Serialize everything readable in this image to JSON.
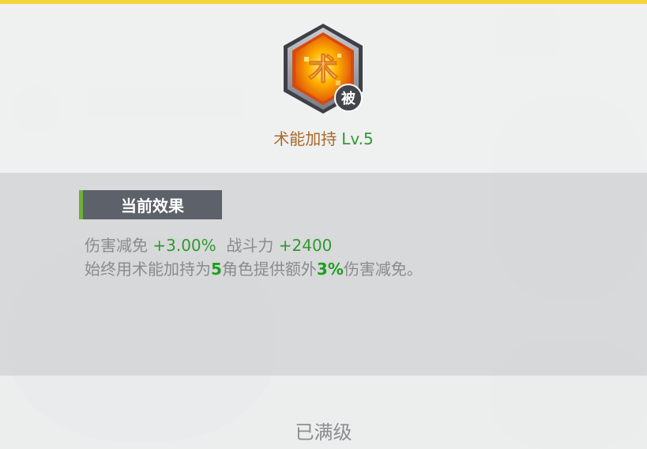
{
  "skill": {
    "name": "术能加持",
    "level": "Lv.5",
    "icon_char": "术",
    "passive_badge": "被",
    "icon_name": "skill-emblem-icon"
  },
  "effect": {
    "header": "当前效果",
    "stat1_label": "伤害减免",
    "stat1_value": "+3.00%",
    "stat2_label": "战斗力",
    "stat2_value": "+2400",
    "desc_part1": "始终用术能加持为",
    "desc_num1": "5",
    "desc_part2": "角色提供额外",
    "desc_num2": "3%",
    "desc_part3": "伤害减免。"
  },
  "footer": {
    "status": "已满级"
  },
  "colors": {
    "name": "#a9692b",
    "level": "#2f9a2f",
    "header_bg": "#5d616a",
    "header_accent": "#6bb13a",
    "highlight": "#2f9a2f"
  }
}
